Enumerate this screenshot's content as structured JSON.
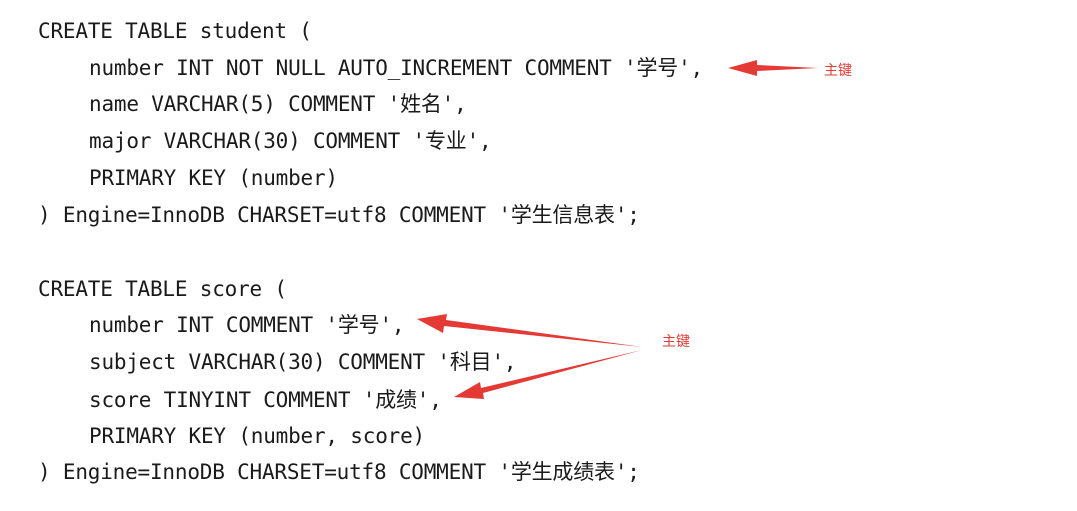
{
  "code": {
    "student": {
      "l1": "CREATE TABLE student (",
      "l2": "number INT NOT NULL AUTO_INCREMENT COMMENT '学号',",
      "l3": "name VARCHAR(5) COMMENT '姓名',",
      "l4": "major VARCHAR(30) COMMENT '专业',",
      "l5": "PRIMARY KEY (number)",
      "l6": ") Engine=InnoDB CHARSET=utf8 COMMENT '学生信息表';"
    },
    "score": {
      "l1": "CREATE TABLE score (",
      "l2": "number INT COMMENT '学号',",
      "l3": "subject VARCHAR(30) COMMENT '科目',",
      "l4": "score TINYINT COMMENT '成绩',",
      "l5": "PRIMARY KEY (number, score)",
      "l6": ") Engine=InnoDB CHARSET=utf8 COMMENT '学生成绩表';"
    }
  },
  "annotations": {
    "primary_key_1": "主键",
    "primary_key_2": "主键",
    "color": "#e53935"
  }
}
